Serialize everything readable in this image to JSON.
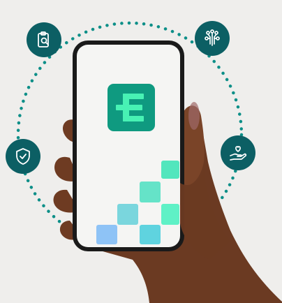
{
  "colors": {
    "background": "#efeeec",
    "accent_teal": "#0c5f64",
    "dotted_ring": "#0d8f88",
    "logo_bg": "#0f9a80",
    "logo_glyph": "#48f2b4",
    "phone_frame": "#1a1a1a",
    "screen": "#f5f5f3",
    "skin": "#6b3a22"
  },
  "logo": {
    "glyph": "E",
    "description": "app-logo-icon"
  },
  "icons": [
    {
      "name": "clipboard-search-icon"
    },
    {
      "name": "circuit-tree-icon"
    },
    {
      "name": "shield-check-icon"
    },
    {
      "name": "hand-heart-icon"
    }
  ],
  "tiles": [
    {
      "color": "#52e6bd"
    },
    {
      "color": "#65e3c8"
    },
    {
      "color": "#7ad6dd"
    },
    {
      "color": "#5ff1c6"
    },
    {
      "color": "#5fd3df"
    },
    {
      "color": "#8ec3f6"
    },
    {
      "color": "#6fe3d7"
    }
  ]
}
